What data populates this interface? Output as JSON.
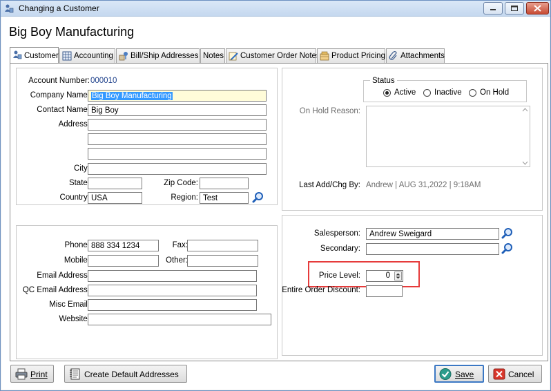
{
  "window": {
    "title": "Changing a Customer"
  },
  "page_title": "Big Boy Manufacturing",
  "tabs": [
    {
      "label": "Customer",
      "icon": "customer-icon"
    },
    {
      "label": "Accounting",
      "icon": "accounting-icon"
    },
    {
      "label": "Bill/Ship Addresses",
      "icon": "address-icon"
    },
    {
      "label": "Notes",
      "icon": ""
    },
    {
      "label": "Customer Order Notes",
      "icon": "order-notes-icon"
    },
    {
      "label": "Product Pricing",
      "icon": "pricing-icon"
    },
    {
      "label": "Attachments",
      "icon": "paperclip-icon"
    }
  ],
  "customer": {
    "account_number_label": "Account Number:",
    "account_number": "000010",
    "company_name_label": "Company Name:",
    "company_name": "Big Boy Manufacturing",
    "contact_name_label": "Contact Name:",
    "contact_name": "Big Boy",
    "address_label": "Address:",
    "address_lines": [
      "",
      "",
      ""
    ],
    "city_label": "City:",
    "city": "",
    "state_label": "State:",
    "state": "",
    "zip_label": "Zip Code:",
    "zip": "",
    "country_label": "Country:",
    "country": "USA",
    "region_label": "Region:",
    "region": "Test"
  },
  "contact": {
    "phone_label": "Phone:",
    "phone": "888 334 1234",
    "fax_label": "Fax:",
    "fax": "",
    "mobile_label": "Mobile:",
    "mobile": "",
    "other_label": "Other:",
    "other": "",
    "email_label": "Email Address:",
    "email": "",
    "qc_email_label": "QC Email Address:",
    "qc_email": "",
    "misc_email_label": "Misc Email:",
    "misc_email": "",
    "website_label": "Website:",
    "website": ""
  },
  "status": {
    "group_label": "Status",
    "options": [
      "Active",
      "Inactive",
      "On Hold"
    ],
    "selected": "Active",
    "on_hold_reason_label": "On Hold Reason:",
    "on_hold_reason": "",
    "last_change_label": "Last Add/Chg By:",
    "last_change_value": "Andrew | AUG 31,2022 | 9:18AM"
  },
  "sales": {
    "salesperson_label": "Salesperson:",
    "salesperson": "Andrew Sweigard",
    "secondary_label": "Secondary:",
    "secondary": "",
    "price_level_label": "Price Level:",
    "price_level": "0",
    "discount_label": "Entire Order Discount:",
    "discount": ""
  },
  "buttons": {
    "print": "Print",
    "create_default": "Create Default Addresses",
    "save": "Save",
    "cancel": "Cancel"
  },
  "colors": {
    "highlight_box": "#e63b3b",
    "selection": "#3399ff",
    "value_blue": "#1c3f8a"
  }
}
